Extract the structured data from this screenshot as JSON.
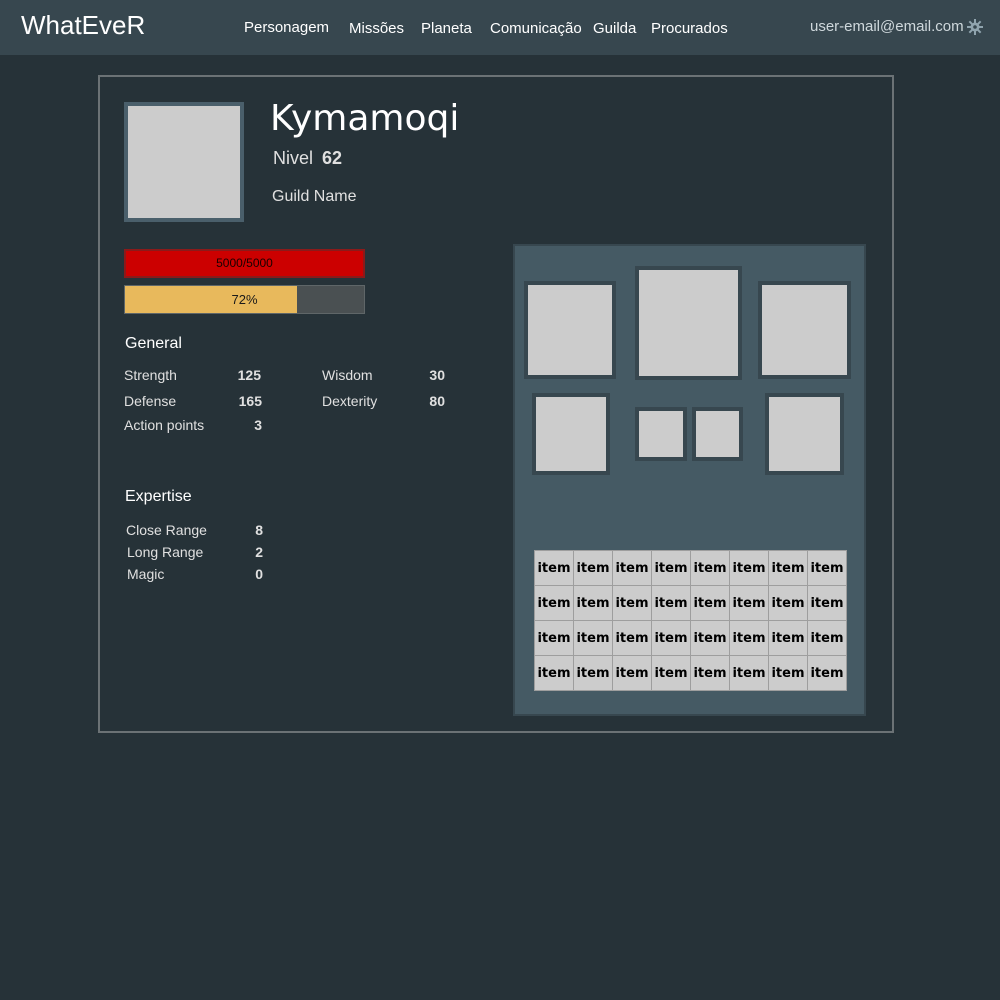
{
  "navbar": {
    "brand": "WhatEveR",
    "items": [
      "Personagem",
      "Missões",
      "Planeta",
      "Comunicação",
      "Guilda",
      "Procurados"
    ],
    "user_email": "user-email@email.com"
  },
  "character": {
    "name": "Kymamoqi",
    "level_label": "Nivel",
    "level": "62",
    "guild": "Guild Name"
  },
  "bars": {
    "hp_text": "5000/5000",
    "hp_fraction": 1.0,
    "xp_text": "72%",
    "xp_fraction": 0.72
  },
  "general": {
    "title": "General",
    "stats": [
      {
        "label": "Strength",
        "value": "125"
      },
      {
        "label": "Wisdom",
        "value": "30"
      },
      {
        "label": "Defense",
        "value": "165"
      },
      {
        "label": "Dexterity",
        "value": "80"
      },
      {
        "label": "Action points",
        "value": "3"
      }
    ]
  },
  "expertise": {
    "title": "Expertise",
    "stats": [
      {
        "label": "Close Range",
        "value": "8"
      },
      {
        "label": "Long Range",
        "value": "2"
      },
      {
        "label": "Magic",
        "value": "0"
      }
    ]
  },
  "inventory": {
    "cell_label": "item",
    "rows": 4,
    "cols": 8
  },
  "colors": {
    "background": "#263238",
    "navbar": "#37474f",
    "panel": "#455a64",
    "hp": "#cc0000",
    "xp": "#e8b95c",
    "slot": "#cccccc"
  }
}
